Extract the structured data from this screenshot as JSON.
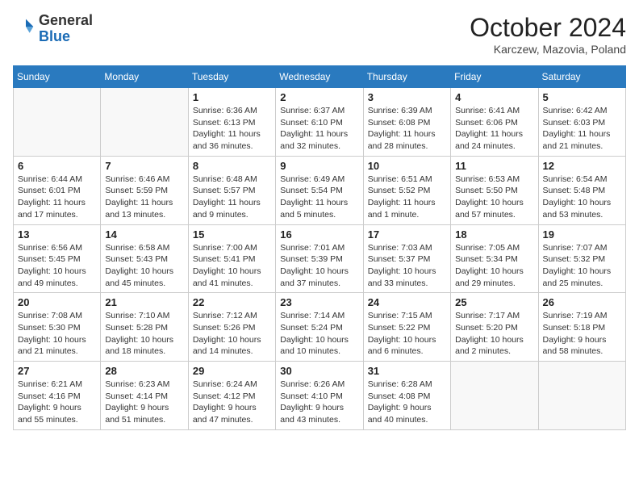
{
  "header": {
    "logo": {
      "general": "General",
      "blue": "Blue"
    },
    "title": "October 2024",
    "location": "Karczew, Mazovia, Poland"
  },
  "weekdays": [
    "Sunday",
    "Monday",
    "Tuesday",
    "Wednesday",
    "Thursday",
    "Friday",
    "Saturday"
  ],
  "weeks": [
    [
      {
        "day": "",
        "info": ""
      },
      {
        "day": "",
        "info": ""
      },
      {
        "day": "1",
        "info": "Sunrise: 6:36 AM\nSunset: 6:13 PM\nDaylight: 11 hours and 36 minutes."
      },
      {
        "day": "2",
        "info": "Sunrise: 6:37 AM\nSunset: 6:10 PM\nDaylight: 11 hours and 32 minutes."
      },
      {
        "day": "3",
        "info": "Sunrise: 6:39 AM\nSunset: 6:08 PM\nDaylight: 11 hours and 28 minutes."
      },
      {
        "day": "4",
        "info": "Sunrise: 6:41 AM\nSunset: 6:06 PM\nDaylight: 11 hours and 24 minutes."
      },
      {
        "day": "5",
        "info": "Sunrise: 6:42 AM\nSunset: 6:03 PM\nDaylight: 11 hours and 21 minutes."
      }
    ],
    [
      {
        "day": "6",
        "info": "Sunrise: 6:44 AM\nSunset: 6:01 PM\nDaylight: 11 hours and 17 minutes."
      },
      {
        "day": "7",
        "info": "Sunrise: 6:46 AM\nSunset: 5:59 PM\nDaylight: 11 hours and 13 minutes."
      },
      {
        "day": "8",
        "info": "Sunrise: 6:48 AM\nSunset: 5:57 PM\nDaylight: 11 hours and 9 minutes."
      },
      {
        "day": "9",
        "info": "Sunrise: 6:49 AM\nSunset: 5:54 PM\nDaylight: 11 hours and 5 minutes."
      },
      {
        "day": "10",
        "info": "Sunrise: 6:51 AM\nSunset: 5:52 PM\nDaylight: 11 hours and 1 minute."
      },
      {
        "day": "11",
        "info": "Sunrise: 6:53 AM\nSunset: 5:50 PM\nDaylight: 10 hours and 57 minutes."
      },
      {
        "day": "12",
        "info": "Sunrise: 6:54 AM\nSunset: 5:48 PM\nDaylight: 10 hours and 53 minutes."
      }
    ],
    [
      {
        "day": "13",
        "info": "Sunrise: 6:56 AM\nSunset: 5:45 PM\nDaylight: 10 hours and 49 minutes."
      },
      {
        "day": "14",
        "info": "Sunrise: 6:58 AM\nSunset: 5:43 PM\nDaylight: 10 hours and 45 minutes."
      },
      {
        "day": "15",
        "info": "Sunrise: 7:00 AM\nSunset: 5:41 PM\nDaylight: 10 hours and 41 minutes."
      },
      {
        "day": "16",
        "info": "Sunrise: 7:01 AM\nSunset: 5:39 PM\nDaylight: 10 hours and 37 minutes."
      },
      {
        "day": "17",
        "info": "Sunrise: 7:03 AM\nSunset: 5:37 PM\nDaylight: 10 hours and 33 minutes."
      },
      {
        "day": "18",
        "info": "Sunrise: 7:05 AM\nSunset: 5:34 PM\nDaylight: 10 hours and 29 minutes."
      },
      {
        "day": "19",
        "info": "Sunrise: 7:07 AM\nSunset: 5:32 PM\nDaylight: 10 hours and 25 minutes."
      }
    ],
    [
      {
        "day": "20",
        "info": "Sunrise: 7:08 AM\nSunset: 5:30 PM\nDaylight: 10 hours and 21 minutes."
      },
      {
        "day": "21",
        "info": "Sunrise: 7:10 AM\nSunset: 5:28 PM\nDaylight: 10 hours and 18 minutes."
      },
      {
        "day": "22",
        "info": "Sunrise: 7:12 AM\nSunset: 5:26 PM\nDaylight: 10 hours and 14 minutes."
      },
      {
        "day": "23",
        "info": "Sunrise: 7:14 AM\nSunset: 5:24 PM\nDaylight: 10 hours and 10 minutes."
      },
      {
        "day": "24",
        "info": "Sunrise: 7:15 AM\nSunset: 5:22 PM\nDaylight: 10 hours and 6 minutes."
      },
      {
        "day": "25",
        "info": "Sunrise: 7:17 AM\nSunset: 5:20 PM\nDaylight: 10 hours and 2 minutes."
      },
      {
        "day": "26",
        "info": "Sunrise: 7:19 AM\nSunset: 5:18 PM\nDaylight: 9 hours and 58 minutes."
      }
    ],
    [
      {
        "day": "27",
        "info": "Sunrise: 6:21 AM\nSunset: 4:16 PM\nDaylight: 9 hours and 55 minutes."
      },
      {
        "day": "28",
        "info": "Sunrise: 6:23 AM\nSunset: 4:14 PM\nDaylight: 9 hours and 51 minutes."
      },
      {
        "day": "29",
        "info": "Sunrise: 6:24 AM\nSunset: 4:12 PM\nDaylight: 9 hours and 47 minutes."
      },
      {
        "day": "30",
        "info": "Sunrise: 6:26 AM\nSunset: 4:10 PM\nDaylight: 9 hours and 43 minutes."
      },
      {
        "day": "31",
        "info": "Sunrise: 6:28 AM\nSunset: 4:08 PM\nDaylight: 9 hours and 40 minutes."
      },
      {
        "day": "",
        "info": ""
      },
      {
        "day": "",
        "info": ""
      }
    ]
  ]
}
